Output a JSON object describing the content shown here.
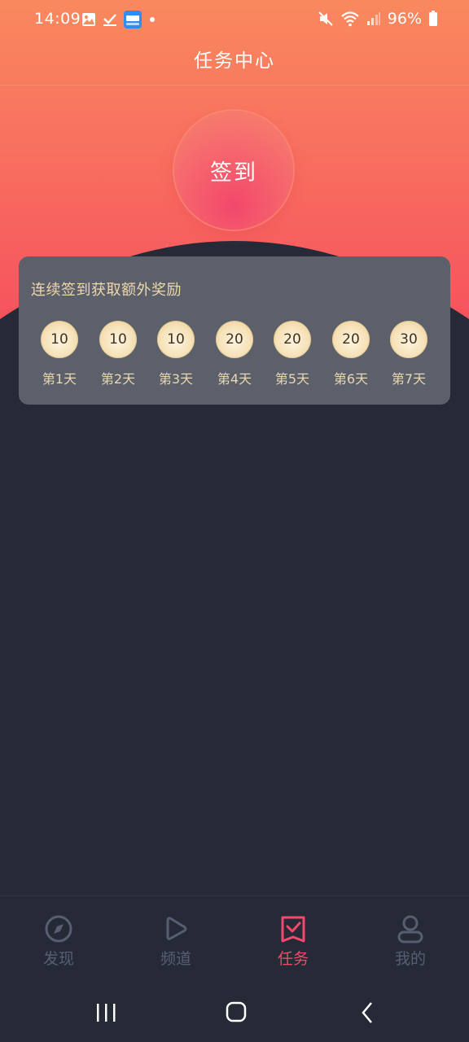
{
  "status_bar": {
    "time": "14:09",
    "battery": "96%",
    "left_icons": [
      "gallery-icon",
      "checkmark-icon",
      "reader-app-icon",
      "dot-icon"
    ],
    "right_icons": [
      "mute-icon",
      "wifi-icon",
      "signal-icon",
      "battery-icon"
    ]
  },
  "header": {
    "title": "任务中心"
  },
  "signin": {
    "label": "签到"
  },
  "rewards": {
    "title": "连续签到获取额外奖励",
    "days": [
      {
        "value": "10",
        "label": "第1天"
      },
      {
        "value": "10",
        "label": "第2天"
      },
      {
        "value": "10",
        "label": "第3天"
      },
      {
        "value": "20",
        "label": "第4天"
      },
      {
        "value": "20",
        "label": "第5天"
      },
      {
        "value": "20",
        "label": "第6天"
      },
      {
        "value": "30",
        "label": "第7天"
      }
    ]
  },
  "bottom_nav": {
    "items": [
      {
        "label": "发现",
        "icon": "compass-icon",
        "active": false
      },
      {
        "label": "频道",
        "icon": "play-icon",
        "active": false
      },
      {
        "label": "任务",
        "icon": "task-check-icon",
        "active": true
      },
      {
        "label": "我的",
        "icon": "profile-icon",
        "active": false
      }
    ]
  },
  "colors": {
    "accent": "#f2486b",
    "background": "#262a37",
    "card": "#5b606b",
    "gold_text": "#f0d7aa"
  }
}
